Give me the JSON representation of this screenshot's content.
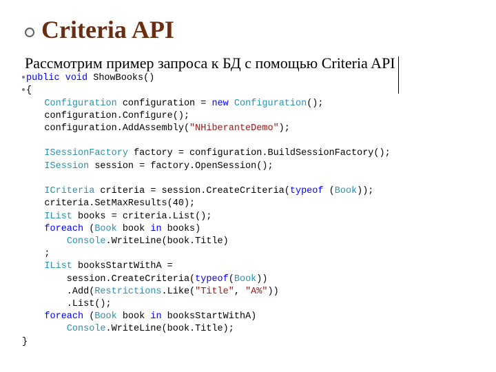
{
  "title": "Criteria API",
  "lead_text": "Рассмотрим пример запроса к БД с помощью Criteria API",
  "code": {
    "l01_kw1": "public",
    "l01_kw2": "void",
    "l01_rest": " ShowBooks()",
    "l02": "{",
    "l03_type": "Configuration",
    "l03_mid": " configuration = ",
    "l03_kw": "new",
    "l03_type2": " Configuration",
    "l03_end": "();",
    "l04": "    configuration.Configure();",
    "l05_a": "    configuration.AddAssembly(",
    "l05_str": "\"NHiberanteDemo\"",
    "l05_b": ");",
    "l06_type": "ISessionFactory",
    "l06_rest": " factory = configuration.BuildSessionFactory();",
    "l07_type": "ISession",
    "l07_rest": " session = factory.OpenSession();",
    "l08_type": "ICriteria",
    "l08_mid": " criteria = session.CreateCriteria(",
    "l08_kw": "typeof",
    "l08_sp": " (",
    "l08_type2": "Book",
    "l08_end": "));",
    "l09": "    criteria.SetMaxResults(40);",
    "l10_type": "IList",
    "l10_rest": " books = criteria.List();",
    "l11_kw1": "foreach",
    "l11_a": " (",
    "l11_type": "Book",
    "l11_b": " book ",
    "l11_kw2": "in",
    "l11_c": " books)",
    "l12_type": "Console",
    "l12_rest": ".WriteLine(book.Title)",
    "l13": "    ;",
    "l14_type": "IList",
    "l14_rest": " booksStartWithA =",
    "l15_a": "        session.CreateCriteria(",
    "l15_kw": "typeof",
    "l15_b": "(",
    "l15_type": "Book",
    "l15_c": "))",
    "l16_a": "        .Add(",
    "l16_type": "Restrictions",
    "l16_b": ".Like(",
    "l16_str1": "\"Title\"",
    "l16_c": ", ",
    "l16_str2": "\"A%\"",
    "l16_d": "))",
    "l17": "        .List();",
    "l18_kw1": "foreach",
    "l18_a": " (",
    "l18_type": "Book",
    "l18_b": " book ",
    "l18_kw2": "in",
    "l18_c": " booksStartWithA)",
    "l19_type": "Console",
    "l19_rest": ".WriteLine(book.Title);",
    "l20": "}"
  }
}
